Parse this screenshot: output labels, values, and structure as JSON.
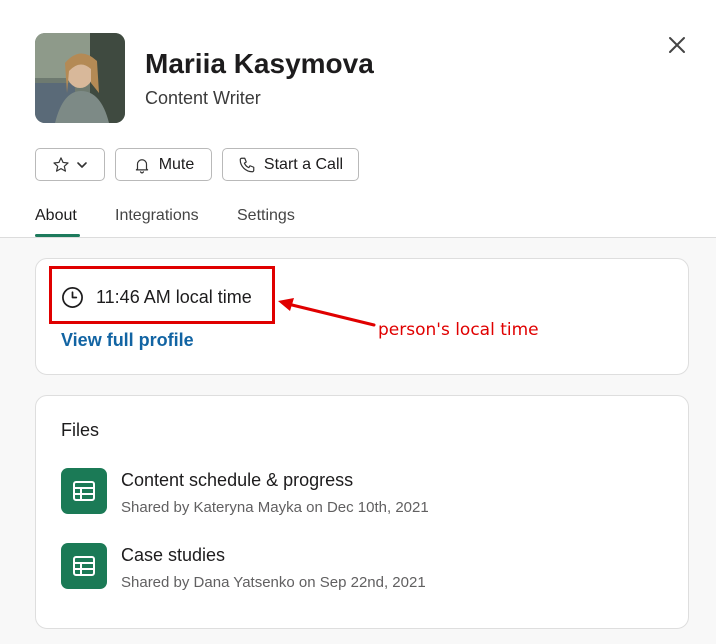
{
  "profile": {
    "name": "Mariia Kasymova",
    "role": "Content Writer"
  },
  "actions": {
    "mute_label": "Mute",
    "call_label": "Start a Call"
  },
  "tabs": [
    {
      "label": "About"
    },
    {
      "label": "Integrations"
    },
    {
      "label": "Settings"
    }
  ],
  "about": {
    "local_time": "11:46 AM local time",
    "view_profile": "View full profile"
  },
  "annotation": {
    "text": "person's local time",
    "color": "#e00000"
  },
  "files": {
    "title": "Files",
    "items": [
      {
        "title": "Content schedule & progress",
        "shared": "Shared by Kateryna Mayka on Dec 10th, 2021"
      },
      {
        "title": "Case studies",
        "shared": "Shared by Dana Yatsenko on Sep 22nd, 2021"
      }
    ]
  },
  "colors": {
    "accent_green": "#1d7a5c",
    "link_blue": "#1264a3",
    "file_icon_bg": "#1b7a56"
  }
}
